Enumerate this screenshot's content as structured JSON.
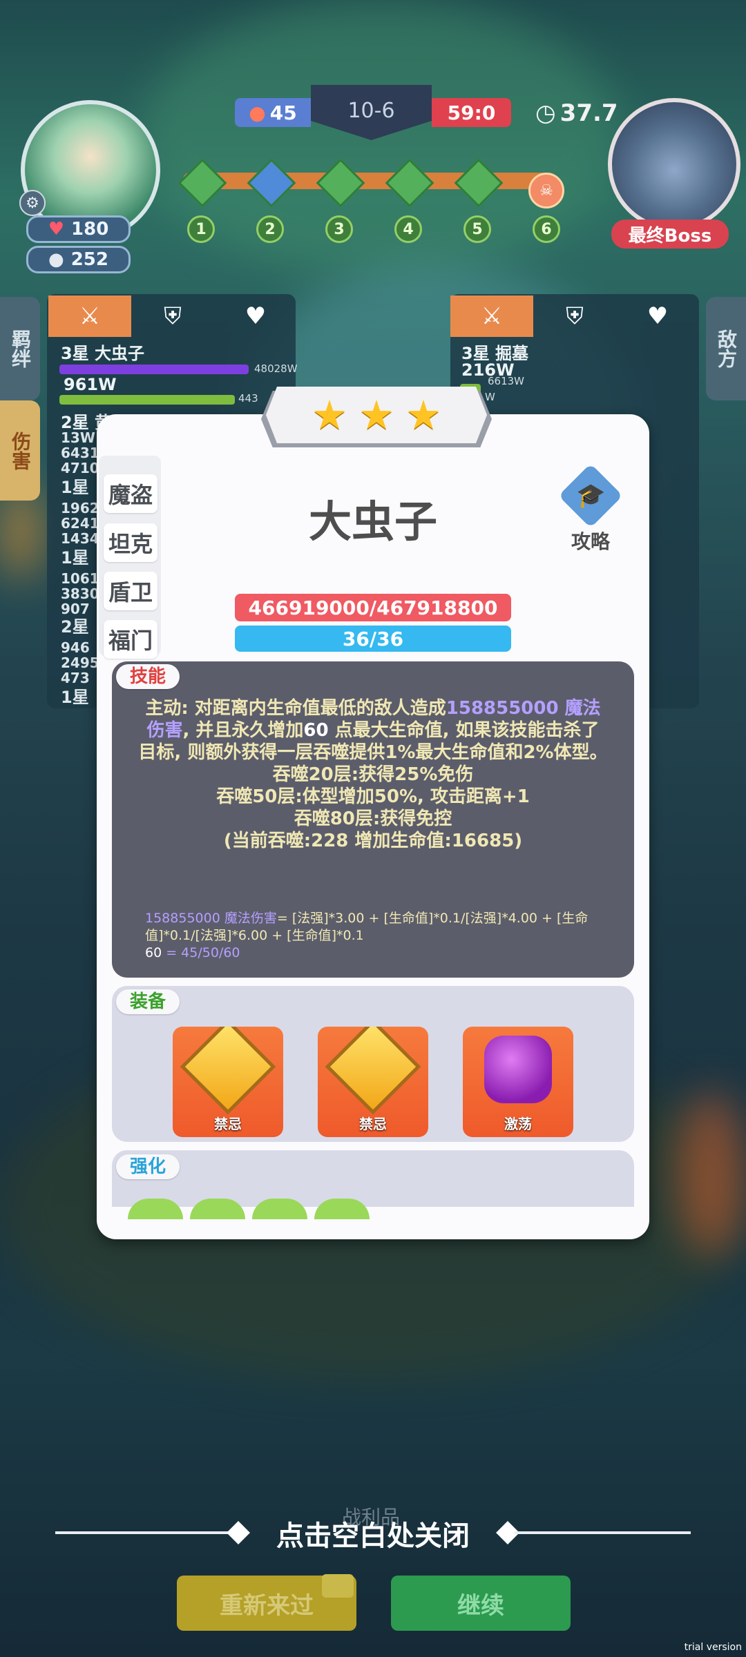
{
  "hud": {
    "player_hp": "180",
    "player_coins": "252",
    "fire_count": "45",
    "level": "10-6",
    "enemy_score": "59:0",
    "timer": "37.7",
    "boss_label": "最终Boss",
    "stages": [
      "1",
      "2",
      "3",
      "4",
      "5",
      "6"
    ]
  },
  "side_tabs": {
    "bond": "羁绊",
    "damage": "伤害",
    "enemy": "敌方"
  },
  "left_panel": {
    "top_name": "3星 大虫子",
    "top_small": "48028W",
    "top_value": "961W",
    "second_small": "443",
    "second_name": "2星 黄...",
    "rows": [
      "13W",
      "6431",
      "4710",
      "1星",
      "1962",
      "6241",
      "1434",
      "1星",
      "1061",
      "3830",
      "907",
      "2星",
      "946",
      "2495",
      "473",
      "1星"
    ]
  },
  "right_panel": {
    "name": "3星 掘墓",
    "value": "216W",
    "small": "6613W",
    "cut_small": "W"
  },
  "modal": {
    "stars": 3,
    "categories": [
      "魔盗",
      "坦克",
      "盾卫",
      "福门"
    ],
    "hero_name": "大虫子",
    "guide_label": "攻略",
    "hp": "466919000/467918800",
    "mp": "36/36",
    "skill_tag": "技能",
    "skill_lines": [
      "主动: 对距离内生命值最低的敌人造成",
      "158855000",
      "魔法伤害",
      ", 并且永久增加",
      "60",
      " 点最大生命值, 如果该技能击杀了目标, 则额外获得一层吞噬提供1%最大生命值和2%体型。",
      "吞噬20层:获得25%免伤",
      "吞噬50层:体型增加50%, 攻击距离+1",
      "吞噬80层:获得免控",
      "(当前吞噬:228 增加生命值:16685)"
    ],
    "formula": {
      "dmg_value": "158855000",
      "dmg_label": "魔法伤害",
      "expr": "= [法强]*3.00 + [生命值]*0.1/[法强]*4.00 + [生命值]*0.1/[法强]*6.00 + [生命值]*0.1",
      "hp_value": "60",
      "hp_expr": " = 45/50/60"
    },
    "equip_tag": "装备",
    "items": [
      "禁忌",
      "禁忌",
      "激荡"
    ],
    "enhance_tag": "强化"
  },
  "footer": {
    "close_hint": "点击空白处关闭",
    "loot": "战利品",
    "retry": "重新来过",
    "continue": "继续",
    "trial": "trial version"
  },
  "colors": {
    "hp_bar": "#ef5a63",
    "mp_bar": "#35b9f0",
    "skill_text": "#f0e8b4",
    "skill_highlight": "#b4a0ff"
  }
}
